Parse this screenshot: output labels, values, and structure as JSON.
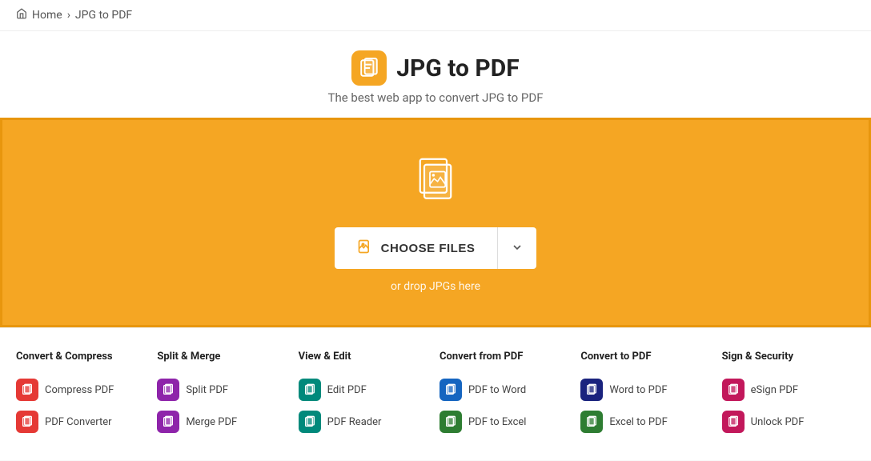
{
  "breadcrumb": {
    "home_label": "Home",
    "separator": "›",
    "current": "JPG to PDF"
  },
  "hero": {
    "title": "JPG to PDF",
    "subtitle": "The best web app to convert JPG to PDF",
    "app_icon_label": "jpg-to-pdf-app-icon"
  },
  "dropzone": {
    "choose_files_label": "CHOOSE FILES",
    "drop_hint": "or drop JPGs here"
  },
  "tools": {
    "columns": [
      {
        "header": "Convert & Compress",
        "items": [
          {
            "label": "Compress PDF",
            "icon_color": "icon-red"
          },
          {
            "label": "PDF Converter",
            "icon_color": "icon-red"
          }
        ]
      },
      {
        "header": "Split & Merge",
        "items": [
          {
            "label": "Split PDF",
            "icon_color": "icon-purple"
          },
          {
            "label": "Merge PDF",
            "icon_color": "icon-purple"
          }
        ]
      },
      {
        "header": "View & Edit",
        "items": [
          {
            "label": "Edit PDF",
            "icon_color": "icon-teal"
          },
          {
            "label": "PDF Reader",
            "icon_color": "icon-teal"
          }
        ]
      },
      {
        "header": "Convert from PDF",
        "items": [
          {
            "label": "PDF to Word",
            "icon_color": "icon-blue"
          },
          {
            "label": "PDF to Excel",
            "icon_color": "icon-green"
          }
        ]
      },
      {
        "header": "Convert to PDF",
        "items": [
          {
            "label": "Word to PDF",
            "icon_color": "icon-dark-blue"
          },
          {
            "label": "Excel to PDF",
            "icon_color": "icon-green"
          }
        ]
      },
      {
        "header": "Sign & Security",
        "items": [
          {
            "label": "eSign PDF",
            "icon_color": "icon-pink"
          },
          {
            "label": "Unlock PDF",
            "icon_color": "icon-pink"
          }
        ]
      }
    ]
  }
}
